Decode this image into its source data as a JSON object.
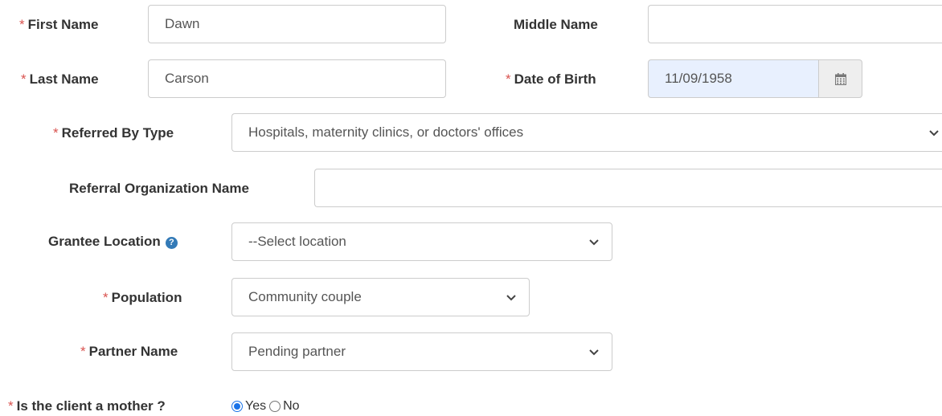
{
  "form": {
    "required_mark": "*",
    "first_name": {
      "label": "First Name",
      "value": "Dawn"
    },
    "middle_name": {
      "label": "Middle Name",
      "value": ""
    },
    "last_name": {
      "label": "Last Name",
      "value": "Carson"
    },
    "date_of_birth": {
      "label": "Date of Birth",
      "value": "11/09/1958"
    },
    "referred_by_type": {
      "label": "Referred By Type",
      "value": "Hospitals, maternity clinics, or doctors' offices"
    },
    "referral_org_name": {
      "label": "Referral Organization Name",
      "value": ""
    },
    "grantee_location": {
      "label": "Grantee Location",
      "value": "--Select location"
    },
    "population": {
      "label": "Population",
      "value": "Community couple"
    },
    "partner_name": {
      "label": "Partner Name",
      "value": "Pending partner"
    },
    "is_mother": {
      "label": "Is the client a mother ?",
      "yes_label": "Yes",
      "no_label": "No",
      "selected": "Yes"
    }
  },
  "colors": {
    "required": "#d9534f",
    "accent": "#1a73e8",
    "help_icon": "#337ab7",
    "date_fill": "#e8f0fe"
  },
  "icons": {
    "calendar": "calendar-icon",
    "chevron": "chevron-down-icon",
    "help": "question-circle-icon"
  }
}
